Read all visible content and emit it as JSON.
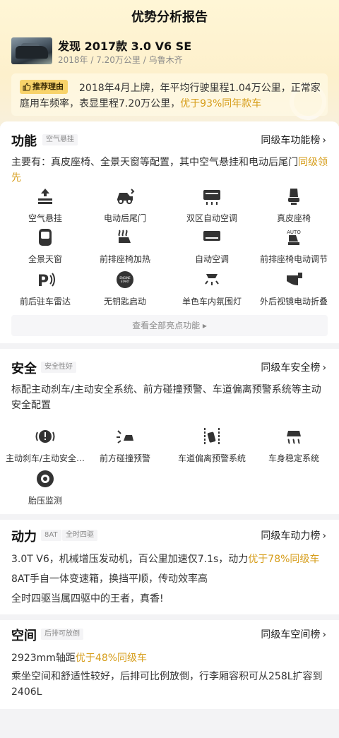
{
  "page_title": "优势分析报告",
  "car": {
    "name": "发现 2017款 3.0 V6 SE",
    "meta": "2018年 / 7.20万公里 / 乌鲁木齐"
  },
  "reason": {
    "tag": "推荐理由",
    "text_main": "2018年4月上牌，年平均行驶里程1.04万公里，正常家庭用车频率，表显里程7.20万公里，",
    "text_highlight": "优于93%同年款车"
  },
  "colors": {
    "highlight": "#d69d1a",
    "tag_bg": "#f8d36a"
  },
  "features_section": {
    "title": "功能",
    "tag": "空气悬挂",
    "rank_link": "同级车功能榜",
    "desc_main": "主要有：真皮座椅、全景天窗等配置，其中空气悬挂和电动后尾门",
    "desc_highlight": "同级领先",
    "items": [
      {
        "label": "空气悬挂",
        "icon": "air-suspension-icon"
      },
      {
        "label": "电动后尾门",
        "icon": "power-tailgate-icon"
      },
      {
        "label": "双区自动空调",
        "icon": "dual-zone-ac-icon"
      },
      {
        "label": "真皮座椅",
        "icon": "leather-seat-icon"
      },
      {
        "label": "全景天窗",
        "icon": "panoramic-sunroof-icon"
      },
      {
        "label": "前排座椅加热",
        "icon": "seat-heating-icon"
      },
      {
        "label": "自动空调",
        "icon": "auto-ac-icon"
      },
      {
        "label": "前排座椅电动调节",
        "icon": "power-seat-icon"
      },
      {
        "label": "前后驻车雷达",
        "icon": "parking-radar-icon"
      },
      {
        "label": "无钥匙启动",
        "icon": "keyless-start-icon"
      },
      {
        "label": "单色车内氛围灯",
        "icon": "ambient-light-icon"
      },
      {
        "label": "外后视镜电动折叠",
        "icon": "mirror-fold-icon"
      }
    ],
    "more": "查看全部亮点功能 ▸"
  },
  "safety_section": {
    "title": "安全",
    "tag": "安全性好",
    "rank_link": "同级车安全榜",
    "desc": "标配主动刹车/主动安全系统、前方碰撞预警、车道偏离预警系统等主动安全配置",
    "items": [
      {
        "label": "主动刹车/主动安全…",
        "icon": "active-brake-icon"
      },
      {
        "label": "前方碰撞预警",
        "icon": "collision-warning-icon"
      },
      {
        "label": "车道偏离预警系统",
        "icon": "lane-departure-icon"
      },
      {
        "label": "车身稳定系统",
        "icon": "stability-control-icon"
      },
      {
        "label": "胎压监测",
        "icon": "tire-pressure-icon"
      }
    ]
  },
  "power_section": {
    "title": "动力",
    "tags": [
      "8AT",
      "全时四驱"
    ],
    "rank_link": "同级车动力榜",
    "line1_main": "3.0T V6，机械增压发动机，百公里加速仅7.1s，动力",
    "line1_highlight": "优于78%同级车",
    "line2": "8AT手自一体变速箱，换挡平顺，传动效率高",
    "line3": "全时四驱当属四驱中的王者，真香!"
  },
  "space_section": {
    "title": "空间",
    "tag": "后排可放倒",
    "rank_link": "同级车空间榜",
    "line1_main": "2923mm轴距",
    "line1_highlight": "优于48%同级车",
    "line2": "乘坐空间和舒适性较好，后排可比例放倒，行李厢容积可从258L扩容到2406L"
  }
}
